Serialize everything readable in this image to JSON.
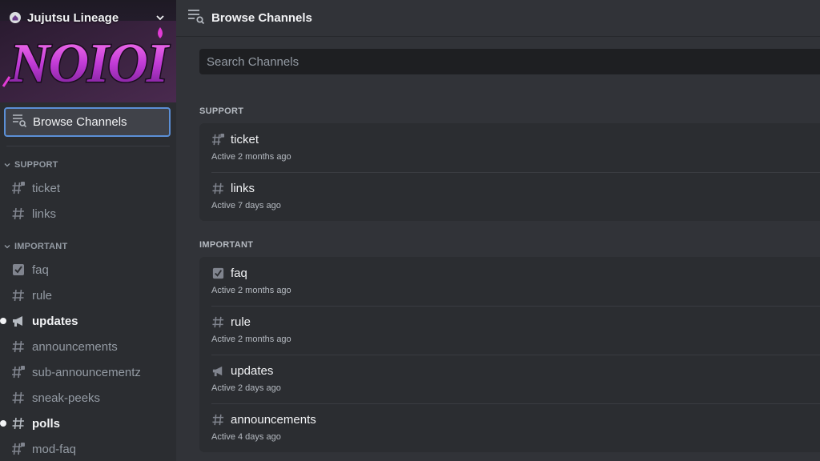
{
  "server": {
    "name": "Jujutsu Lineage",
    "badge_icon": "home-badge-icon",
    "banner_text": "NOIOI",
    "banner_accent": "#c13bd6"
  },
  "sidebar": {
    "browse_label": "Browse Channels",
    "categories": [
      {
        "label": "SUPPORT",
        "channels": [
          {
            "name": "ticket",
            "icon": "hash-lock-icon",
            "unread": false
          },
          {
            "name": "links",
            "icon": "hash-icon",
            "unread": false
          }
        ]
      },
      {
        "label": "IMPORTANT",
        "channels": [
          {
            "name": "faq",
            "icon": "checkbox-icon",
            "unread": false
          },
          {
            "name": "rule",
            "icon": "hash-icon",
            "unread": false
          },
          {
            "name": "updates",
            "icon": "megaphone-icon",
            "unread": true
          },
          {
            "name": "announcements",
            "icon": "hash-icon",
            "unread": false
          },
          {
            "name": "sub-announcementz",
            "icon": "hash-lock-icon",
            "unread": false
          },
          {
            "name": "sneak-peeks",
            "icon": "hash-icon",
            "unread": false
          },
          {
            "name": "polls",
            "icon": "hash-icon",
            "unread": true
          },
          {
            "name": "mod-faq",
            "icon": "hash-lock-icon",
            "unread": false
          }
        ]
      }
    ]
  },
  "main": {
    "title": "Browse Channels",
    "search_placeholder": "Search Channels",
    "sections": [
      {
        "label": "SUPPORT",
        "channels": [
          {
            "name": "ticket",
            "icon": "hash-lock-icon",
            "activity": "Active 2 months ago"
          },
          {
            "name": "links",
            "icon": "hash-icon",
            "activity": "Active 7 days ago"
          }
        ]
      },
      {
        "label": "IMPORTANT",
        "channels": [
          {
            "name": "faq",
            "icon": "checkbox-icon",
            "activity": "Active 2 months ago"
          },
          {
            "name": "rule",
            "icon": "hash-icon",
            "activity": "Active 2 months ago"
          },
          {
            "name": "updates",
            "icon": "megaphone-icon",
            "activity": "Active 2 days ago"
          },
          {
            "name": "announcements",
            "icon": "hash-icon",
            "activity": "Active 4 days ago"
          }
        ]
      }
    ]
  }
}
